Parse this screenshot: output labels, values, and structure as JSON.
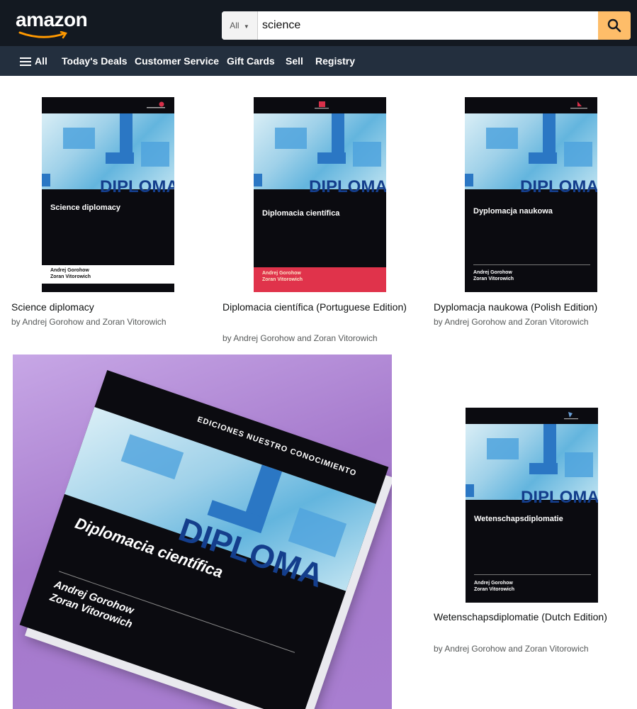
{
  "header": {
    "logo": "amazon",
    "search": {
      "dept": "All",
      "query": "science"
    }
  },
  "nav": {
    "all": "All",
    "items": [
      "Today's Deals",
      "Customer Service",
      "Gift Cards",
      "Sell",
      "Registry"
    ]
  },
  "results": [
    {
      "cover_title": "Science diplomacy",
      "cover_authors": [
        "Andrej Gorohow",
        "Zoran Vitorowich"
      ],
      "title": "Science diplomacy",
      "byline": "by Andrej Gorohow and Zoran Vitorowich"
    },
    {
      "cover_title": "Diplomacia científica",
      "cover_authors": [
        "Andrej Gorohow",
        "Zoran Vitorowich"
      ],
      "title": "Diplomacia científica (Portuguese Edition)",
      "byline": "by Andrej Gorohow and Zoran Vitorowich"
    },
    {
      "cover_title": "Dyplomacja naukowa",
      "cover_authors": [
        "Andrej Gorohow",
        "Zoran Vitorowich"
      ],
      "title": "Dyplomacja naukowa (Polish Edition)",
      "byline": "by Andrej Gorohow and Zoran Vitorowich"
    },
    {
      "cover_title": "Wetenschapsdiplomatie",
      "cover_authors": [
        "Andrej Gorohow",
        "Zoran Vitorowich"
      ],
      "title": "Wetenschapsdiplomatie (Dutch Edition)",
      "byline": "by Andrej Gorohow and Zoran Vitorowich"
    }
  ],
  "cover_stamp": "DIPLOMA",
  "photo_book": {
    "publisher": "EDICIONES NUESTRO CONOCIMIENTO",
    "title": "Diplomacia científica",
    "authors": [
      "Andrej Gorohow",
      "Zoran Vitorowich"
    ],
    "stamp": "DIPLOMA"
  },
  "colors": {
    "header_bg": "#131921",
    "nav_bg": "#232f3e",
    "search_button": "#febd69",
    "cover_black": "#0b0b10",
    "portuguese_band": "#e0334b",
    "stamp_blue": "#143e8c"
  }
}
